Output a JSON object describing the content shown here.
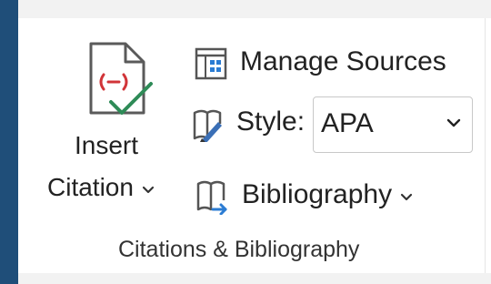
{
  "ribbon_group": {
    "insert_citation": {
      "label_line1": "Insert",
      "label_line2": "Citation",
      "chevron": "⌄",
      "icon": "insert-citation-icon"
    },
    "manage_sources": {
      "label": "Manage Sources",
      "icon": "manage-sources-icon"
    },
    "style": {
      "label": "Style:",
      "value": "APA",
      "icon": "style-icon"
    },
    "bibliography": {
      "label": "Bibliography",
      "chevron": "⌄",
      "icon": "bibliography-icon"
    },
    "group_title": "Citations & Bibliography"
  },
  "colors": {
    "accent_bar": "#1f4e79",
    "citation_red": "#d13438",
    "check_green": "#2e8b57",
    "icon_blue": "#2b7cd3",
    "pen_blue": "#3a6fb6"
  }
}
